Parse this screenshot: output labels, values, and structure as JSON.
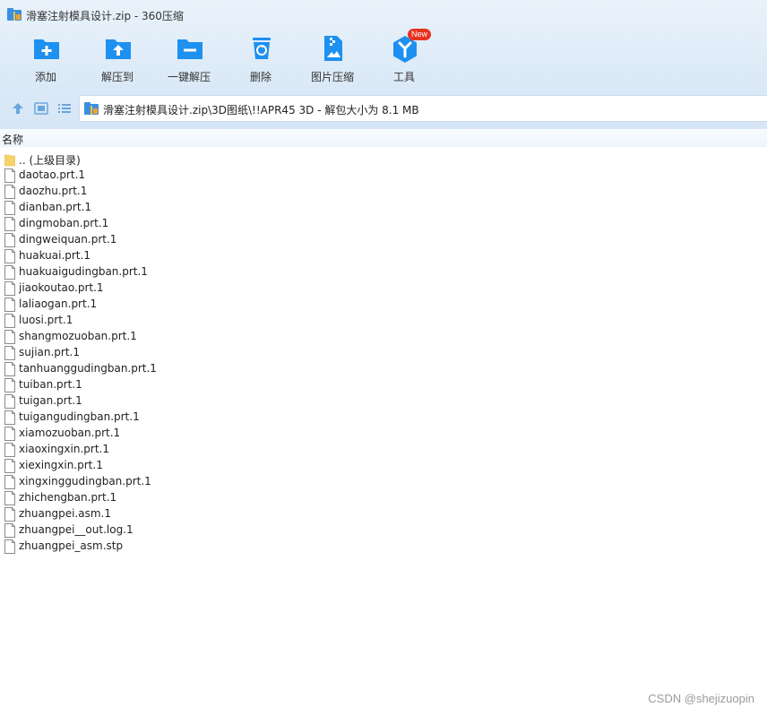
{
  "window": {
    "title": "滑塞注射模具设计.zip - 360压缩"
  },
  "toolbar": {
    "items": [
      {
        "label": "添加",
        "icon": "add-icon"
      },
      {
        "label": "解压到",
        "icon": "extract-to-icon"
      },
      {
        "label": "一键解压",
        "icon": "one-click-extract-icon"
      },
      {
        "label": "删除",
        "icon": "delete-icon"
      },
      {
        "label": "图片压缩",
        "icon": "image-compress-icon"
      },
      {
        "label": "工具",
        "icon": "tools-icon",
        "badge": "New"
      }
    ]
  },
  "address": {
    "path": "滑塞注射模具设计.zip\\3D图纸\\!!APR45 3D - 解包大小为 8.1 MB"
  },
  "columns": {
    "name": "名称"
  },
  "files": [
    ".. (上级目录)",
    "daotao.prt.1",
    "daozhu.prt.1",
    "dianban.prt.1",
    "dingmoban.prt.1",
    "dingweiquan.prt.1",
    "huakuai.prt.1",
    "huakuaigudingban.prt.1",
    "jiaokoutao.prt.1",
    "laliaogan.prt.1",
    "luosi.prt.1",
    "shangmozuoban.prt.1",
    "sujian.prt.1",
    "tanhuanggudingban.prt.1",
    "tuiban.prt.1",
    "tuigan.prt.1",
    "tuigangudingban.prt.1",
    "xiamozuoban.prt.1",
    "xiaoxingxin.prt.1",
    "xiexingxin.prt.1",
    "xingxinggudingban.prt.1",
    "zhichengban.prt.1",
    "zhuangpei.asm.1",
    "zhuangpei__out.log.1",
    "zhuangpei_asm.stp"
  ],
  "watermark": "CSDN @shejizuopin",
  "colors": {
    "accent": "#1e90f0",
    "toolbar_bg": "#dceaf7",
    "badge": "#e8321e"
  }
}
